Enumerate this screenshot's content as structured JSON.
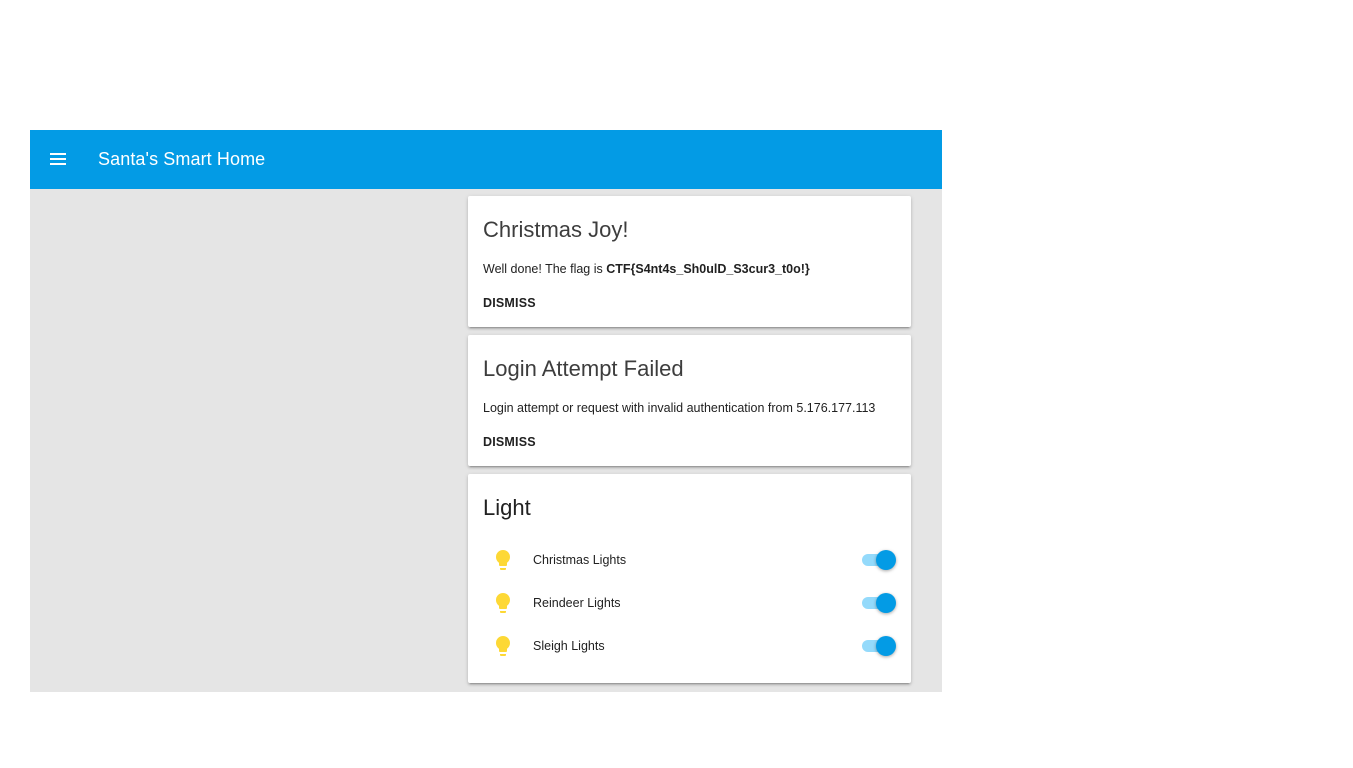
{
  "app": {
    "title": "Santa's Smart Home",
    "accent_color": "#039be5",
    "menu_icon": "menu-icon"
  },
  "notifications": [
    {
      "title": "Christmas Joy!",
      "message_prefix": "Well done! The flag is ",
      "message_bold": "CTF{S4nt4s_Sh0ulD_S3cur3_t0o!}",
      "dismiss_label": "DISMISS"
    },
    {
      "title": "Login Attempt Failed",
      "message": "Login attempt or request with invalid authentication from 5.176.177.113",
      "dismiss_label": "DISMISS"
    }
  ],
  "light_card": {
    "title": "Light",
    "icon_color": "#fdd835",
    "entities": [
      {
        "name": "Christmas Lights",
        "icon": "lightbulb-icon",
        "on": true
      },
      {
        "name": "Reindeer Lights",
        "icon": "lightbulb-icon",
        "on": true
      },
      {
        "name": "Sleigh Lights",
        "icon": "lightbulb-icon",
        "on": true
      }
    ]
  }
}
